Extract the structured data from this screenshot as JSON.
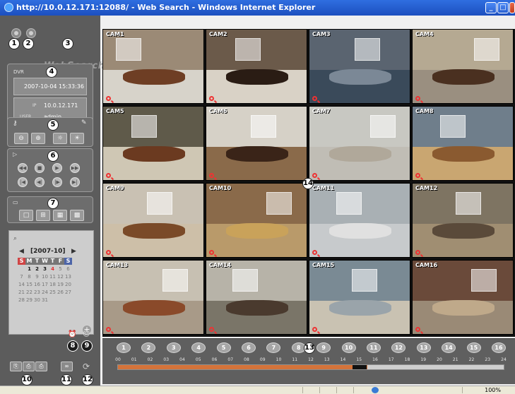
{
  "window": {
    "title": "http://10.0.12.171:12088/ - Web Search - Windows Internet Explorer",
    "min_label": "_",
    "max_label": "□",
    "close_label": "X"
  },
  "logo": "WebSearch",
  "callouts": [
    "1",
    "2",
    "3",
    "4",
    "5",
    "6",
    "7",
    "8",
    "9",
    "10",
    "11",
    "12",
    "13",
    "14"
  ],
  "info": {
    "dvr_label": "DVR",
    "datetime": "2007-10-04 15:33:36",
    "ip_label": "IP",
    "ip": "10.0.12.171",
    "user_label": "USER",
    "user": "admin"
  },
  "image_controls": {
    "zoom_out_icon": "zoom-out-icon",
    "zoom_in_icon": "zoom-in-icon",
    "brightness_down_icon": "brightness-down-icon",
    "brightness_up_icon": "brightness-up-icon"
  },
  "calendar": {
    "month_label": "[2007-10]",
    "prev": "◀",
    "next": "▶",
    "weekdays": [
      "S",
      "M",
      "T",
      "W",
      "T",
      "F",
      "S"
    ],
    "weeks": [
      [
        "",
        "1",
        "2",
        "3",
        "4",
        "5",
        "6"
      ],
      [
        "7",
        "8",
        "9",
        "10",
        "11",
        "12",
        "13"
      ],
      [
        "14",
        "15",
        "16",
        "17",
        "18",
        "19",
        "20"
      ],
      [
        "21",
        "22",
        "23",
        "24",
        "25",
        "26",
        "27"
      ],
      [
        "28",
        "29",
        "30",
        "31",
        "",
        "",
        ""
      ]
    ],
    "active_days": [
      "1",
      "2",
      "3",
      "4"
    ],
    "today": "4"
  },
  "cameras": [
    {
      "label": "CAM1",
      "wall": "#9b8a76",
      "floor": "#d7d3ca",
      "table": "#6e3e24"
    },
    {
      "label": "CAM2",
      "wall": "#6b5a4a",
      "floor": "#d9d2c6",
      "table": "#2a1c14"
    },
    {
      "label": "CAM3",
      "wall": "#5a6470",
      "floor": "#3a4a5a",
      "table": "#7b8896"
    },
    {
      "label": "CAM4",
      "wall": "#b5a992",
      "floor": "#9a8f80",
      "table": "#4a3020"
    },
    {
      "label": "CAM5",
      "wall": "#5f5a4a",
      "floor": "#cfc7b4",
      "table": "#6b3a20"
    },
    {
      "label": "CAM6",
      "wall": "#d6d1c7",
      "floor": "#8a6a4a",
      "table": "#3a2418"
    },
    {
      "label": "CAM7",
      "wall": "#c8c8c2",
      "floor": "#c0bdb5",
      "table": "#b0a89a"
    },
    {
      "label": "CAM8",
      "wall": "#6f7e8b",
      "floor": "#c9a671",
      "table": "#8a5a30"
    },
    {
      "label": "CAM9",
      "wall": "#c9c1b3",
      "floor": "#cdbfa8",
      "table": "#7a4a28"
    },
    {
      "label": "CAM10",
      "wall": "#8a6a4a",
      "floor": "#b99a6a",
      "table": "#c9a25a"
    },
    {
      "label": "CAM11",
      "wall": "#a9b0b4",
      "floor": "#c7cacc",
      "table": "#e0e0e0"
    },
    {
      "label": "CAM12",
      "wall": "#7e7462",
      "floor": "#a08e72",
      "table": "#5a4a3a"
    },
    {
      "label": "CAM13",
      "wall": "#c7c0b2",
      "floor": "#a89a88",
      "table": "#8a4a2a"
    },
    {
      "label": "CAM14",
      "wall": "#b7b3a8",
      "floor": "#7a7568",
      "table": "#4a3a2e"
    },
    {
      "label": "CAM15",
      "wall": "#7a8a94",
      "floor": "#c9c2b2",
      "table": "#9aa4aa"
    },
    {
      "label": "CAM16",
      "wall": "#6a4a3a",
      "floor": "#9a8a76",
      "table": "#bfa98a"
    }
  ],
  "timeline": {
    "channels": [
      "1",
      "2",
      "3",
      "4",
      "5",
      "6",
      "7",
      "8",
      "9",
      "10",
      "11",
      "12",
      "13",
      "14",
      "15",
      "16"
    ],
    "hours": [
      "00",
      "01",
      "02",
      "03",
      "04",
      "05",
      "06",
      "07",
      "08",
      "09",
      "10",
      "11",
      "12",
      "13",
      "14",
      "15",
      "16",
      "17",
      "18",
      "19",
      "20",
      "21",
      "22",
      "23",
      "24"
    ],
    "recorded_until_hour": 15.5,
    "cursor_hour": 14.6
  },
  "statusbar": {
    "zoom": "100%"
  }
}
